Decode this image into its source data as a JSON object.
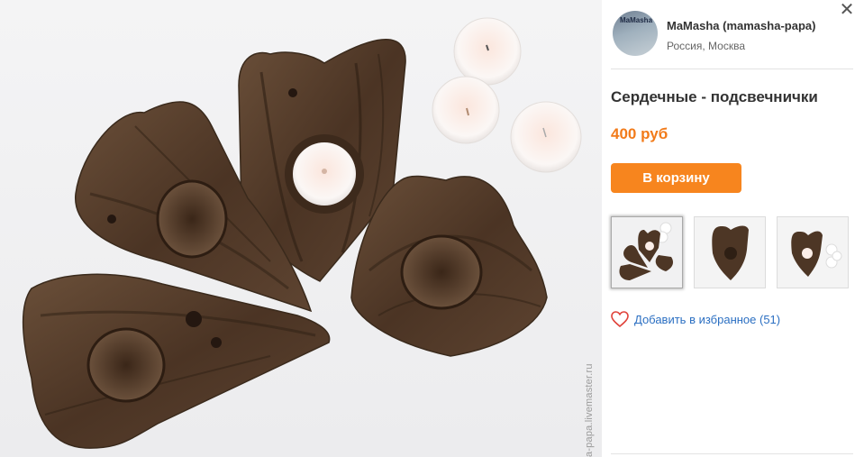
{
  "seller": {
    "name": "MaMasha (mamasha-papa)",
    "location": "Россия, Москва",
    "avatar_text": "MaMasha"
  },
  "product": {
    "title": "Сердечные - подсвечнички",
    "price": "400 руб",
    "cart_label": "В корзину"
  },
  "favorites": {
    "label": "Добавить в избранное (51)"
  },
  "photo": {
    "watermark": "a-papa.livemaster.ru"
  },
  "thumbnails": [
    {
      "name": "thumb-1",
      "active": true
    },
    {
      "name": "thumb-2",
      "active": false
    },
    {
      "name": "thumb-3",
      "active": false
    }
  ],
  "icons": {
    "close": "close-icon",
    "heart": "heart-icon"
  },
  "colors": {
    "accent": "#f7851e",
    "price": "#f27b1a",
    "link": "#2b6fc2",
    "heart": "#e0423a"
  }
}
